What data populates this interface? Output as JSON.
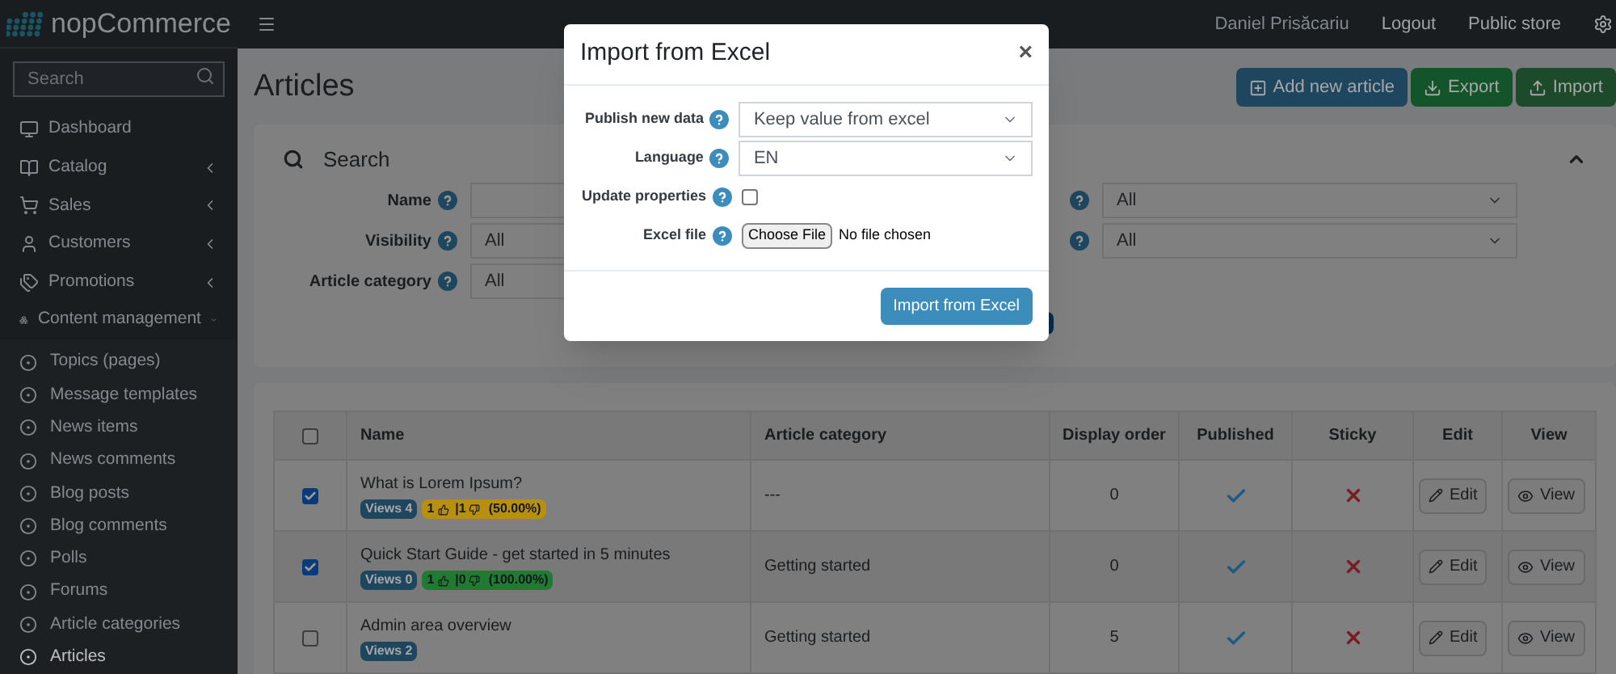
{
  "brand": {
    "name": "nopCommerce"
  },
  "topbar": {
    "user": "Daniel Prisăcariu",
    "links": [
      "Logout",
      "Public store"
    ]
  },
  "sidebar": {
    "search_placeholder": "Search",
    "items": [
      {
        "label": "Dashboard",
        "expandable": false,
        "expanded": false,
        "selected": false
      },
      {
        "label": "Catalog",
        "expandable": true,
        "expanded": false,
        "selected": false
      },
      {
        "label": "Sales",
        "expandable": true,
        "expanded": false,
        "selected": false
      },
      {
        "label": "Customers",
        "expandable": true,
        "expanded": false,
        "selected": false
      },
      {
        "label": "Promotions",
        "expandable": true,
        "expanded": false,
        "selected": false
      },
      {
        "label": "Content management",
        "expandable": true,
        "expanded": true,
        "selected": false,
        "children": [
          {
            "label": "Topics (pages)",
            "selected": false
          },
          {
            "label": "Message templates",
            "selected": false
          },
          {
            "label": "News items",
            "selected": false
          },
          {
            "label": "News comments",
            "selected": false
          },
          {
            "label": "Blog posts",
            "selected": false
          },
          {
            "label": "Blog comments",
            "selected": false
          },
          {
            "label": "Polls",
            "selected": false
          },
          {
            "label": "Forums",
            "selected": false
          },
          {
            "label": "Article categories",
            "selected": false
          },
          {
            "label": "Articles",
            "selected": true
          }
        ]
      }
    ]
  },
  "page": {
    "title": "Articles",
    "actions": [
      {
        "label": "Add new article",
        "kind": "add"
      },
      {
        "label": "Export",
        "kind": "export"
      },
      {
        "label": "Import",
        "kind": "import"
      }
    ]
  },
  "search": {
    "title": "Search",
    "expanded": true,
    "left_fields": [
      {
        "label": "Name",
        "kind": "text"
      },
      {
        "label": "Visibility",
        "kind": "select",
        "value": "All"
      },
      {
        "label": "Article category",
        "kind": "select",
        "value": "All"
      }
    ],
    "right_fields": [
      {
        "value": "All"
      },
      {
        "value": "All"
      }
    ]
  },
  "table": {
    "columns": [
      "Name",
      "Article category",
      "Display order",
      "Published",
      "Sticky",
      "Edit",
      "View"
    ],
    "all_checked": false,
    "rows": [
      {
        "checked": true,
        "name": "What is Lorem Ipsum?",
        "views": "Views 4",
        "rating": {
          "likes": "1",
          "dislikes": "|1",
          "percent": "(50.00%)",
          "color": "#b8900f"
        },
        "category": "---",
        "display_order": "0",
        "published": true,
        "sticky": false,
        "edit": "Edit",
        "view": "View"
      },
      {
        "checked": true,
        "name": "Quick Start Guide - get started in 5 minutes",
        "views": "Views 0",
        "rating": {
          "likes": "1",
          "dislikes": "|0",
          "percent": "(100.00%)",
          "color": "#1f7a32"
        },
        "category": "Getting started",
        "display_order": "0",
        "published": true,
        "sticky": false,
        "edit": "Edit",
        "view": "View"
      },
      {
        "checked": false,
        "name": "Admin area overview",
        "views": "Views 2",
        "category": "Getting started",
        "display_order": "5",
        "published": true,
        "sticky": false,
        "edit": "Edit",
        "view": "View"
      }
    ]
  },
  "modal": {
    "title": "Import from Excel",
    "close": "×",
    "fields": [
      {
        "kind": "select",
        "label": "Publish new data",
        "value": "Keep value from excel"
      },
      {
        "kind": "select",
        "label": "Language",
        "value": "EN"
      },
      {
        "kind": "checkbox",
        "label": "Update properties",
        "checked": false
      },
      {
        "kind": "file",
        "label": "Excel file",
        "button": "Choose File",
        "value": "No file chosen"
      }
    ],
    "submit": "Import from Excel"
  }
}
